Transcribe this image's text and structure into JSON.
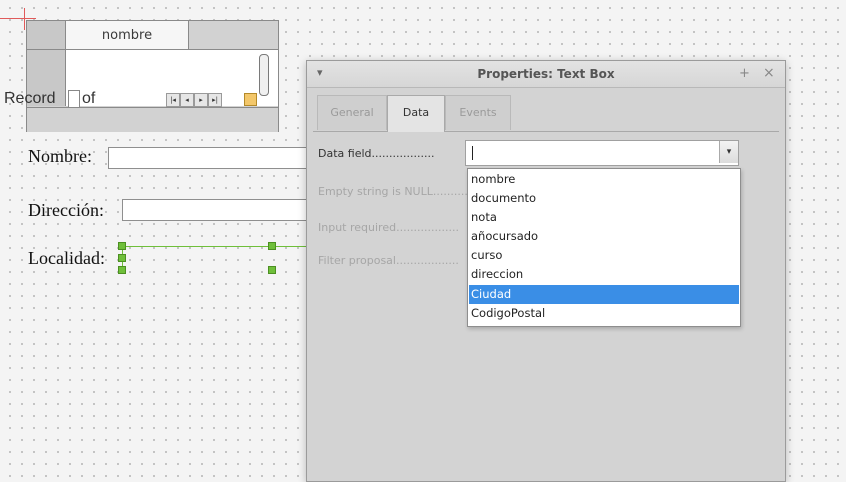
{
  "table_control": {
    "column_header": "nombre",
    "navigation": {
      "record_label": "Record",
      "of_label": "of",
      "buttons": [
        "|◂",
        "◂",
        "▸",
        "▸|"
      ]
    }
  },
  "form": {
    "labels": {
      "nombre": "Nombre:",
      "direccion": "Dirección:",
      "localidad": "Localidad:"
    }
  },
  "dialog": {
    "title": "Properties: Text Box",
    "menu_glyph": "▾",
    "pin_glyph": "+",
    "close_glyph": "×",
    "tabs": [
      {
        "label": "General",
        "active": false
      },
      {
        "label": "Data",
        "active": true
      },
      {
        "label": "Events",
        "active": false
      }
    ],
    "properties": [
      {
        "label": "Data field",
        "enabled": true
      },
      {
        "label": "Empty string is NULL",
        "enabled": false
      },
      {
        "label": "Input required",
        "enabled": false
      },
      {
        "label": "Filter proposal",
        "enabled": false
      }
    ],
    "data_field_value": "",
    "dropdown_button_glyph": "▾",
    "dropdown_options": [
      {
        "label": "nombre",
        "selected": false
      },
      {
        "label": "documento",
        "selected": false
      },
      {
        "label": "nota",
        "selected": false
      },
      {
        "label": "añocursado",
        "selected": false
      },
      {
        "label": "curso",
        "selected": false
      },
      {
        "label": "direccion",
        "selected": false
      },
      {
        "label": "Ciudad",
        "selected": true
      },
      {
        "label": "CodigoPostal",
        "selected": false
      }
    ]
  },
  "colors": {
    "selection_highlight": "#3a8ee6",
    "control_handle": "#6fbf3a"
  }
}
